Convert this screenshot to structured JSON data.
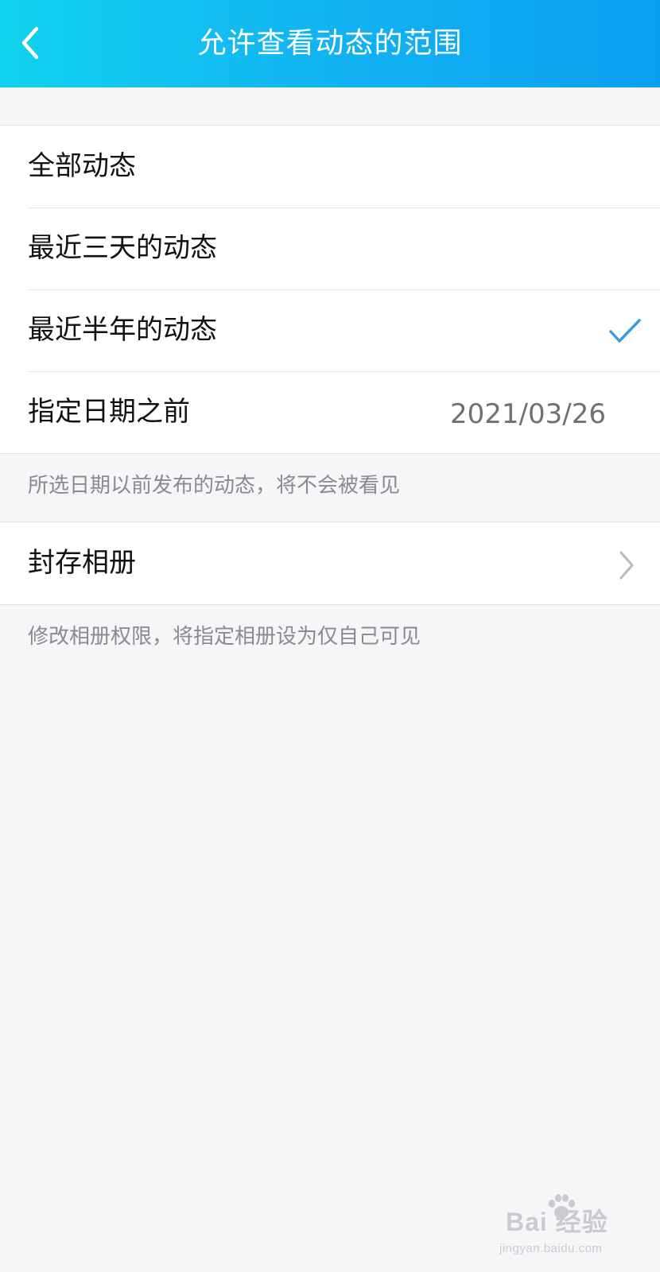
{
  "header": {
    "title": "允许查看动态的范围"
  },
  "range_options": [
    {
      "label": "全部动态",
      "selected": false
    },
    {
      "label": "最近三天的动态",
      "selected": false
    },
    {
      "label": "最近半年的动态",
      "selected": true
    },
    {
      "label": "指定日期之前",
      "value": "2021/03/26",
      "selected": false
    }
  ],
  "range_note": "所选日期以前发布的动态，将不会被看见",
  "album": {
    "label": "封存相册",
    "note": "修改相册权限，将指定相册设为仅自己可见"
  },
  "watermark": {
    "brand": "Bai 经验",
    "url": "jingyan.baidu.com"
  },
  "colors": {
    "header_gradient_start": "#11d3ef",
    "header_gradient_end": "#0b9ff1",
    "check_color": "#3a9be0",
    "background": "#f5f6f8"
  }
}
